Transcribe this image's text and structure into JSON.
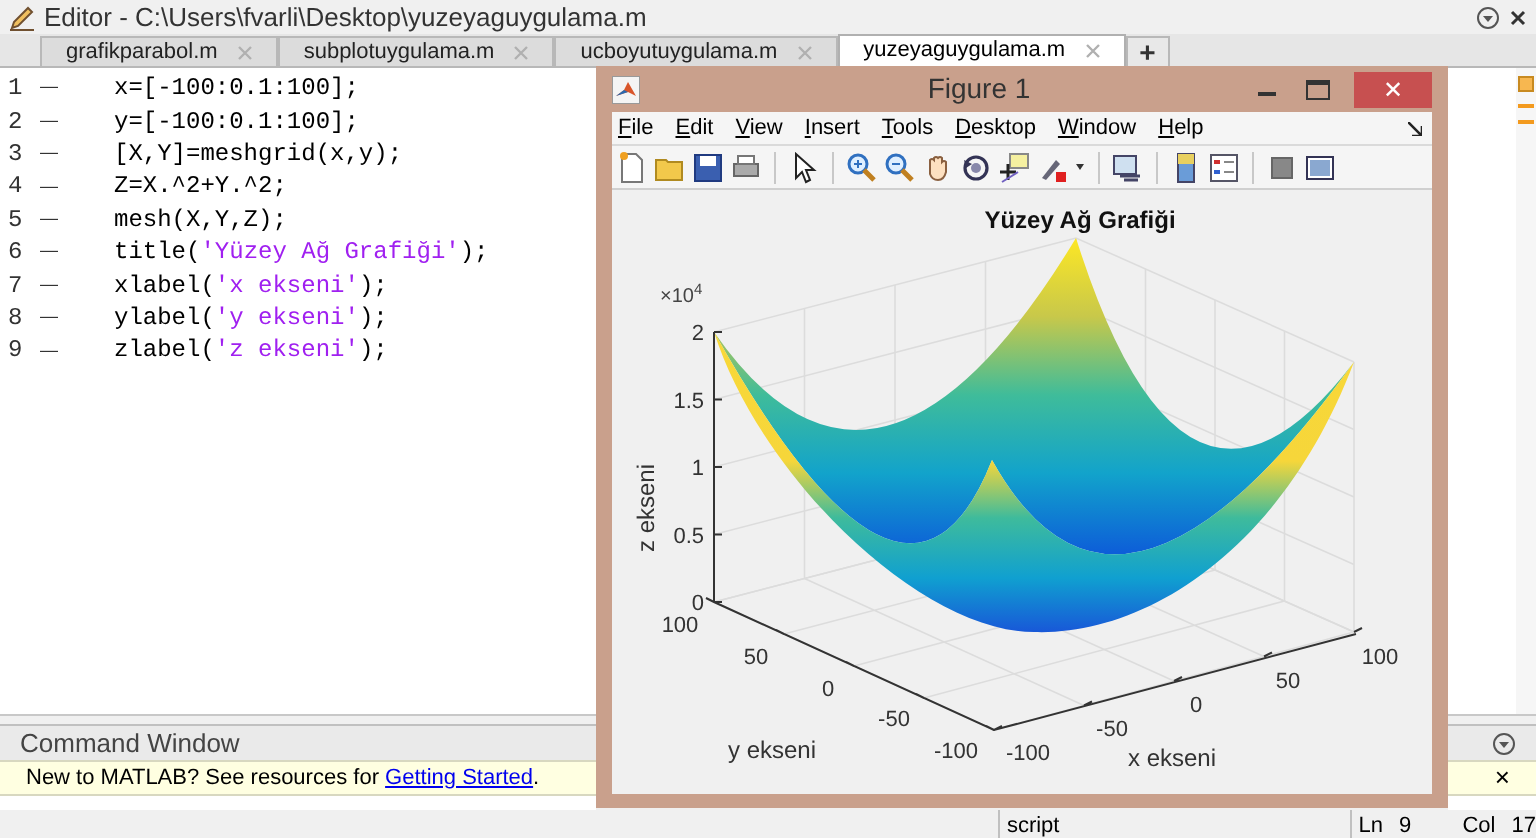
{
  "editor": {
    "title": "Editor - C:\\Users\\fvarli\\Desktop\\yuzeyaguygulama.m",
    "tabs": [
      {
        "label": "grafikparabol.m",
        "selected": false
      },
      {
        "label": "subplotuygulama.m",
        "selected": false
      },
      {
        "label": "ucboyutuygulama.m",
        "selected": false
      },
      {
        "label": "yuzeyaguygulama.m",
        "selected": true
      }
    ],
    "new_tab": "+",
    "lines": [
      {
        "number": "1",
        "marker": "—",
        "segments": [
          {
            "kind": "code",
            "text": "x=[-100:0.1:100];"
          }
        ]
      },
      {
        "number": "2",
        "marker": "—",
        "segments": [
          {
            "kind": "code",
            "text": "y=[-100:0.1:100];"
          }
        ]
      },
      {
        "number": "3",
        "marker": "—",
        "segments": [
          {
            "kind": "code",
            "text": "[X,Y]=meshgrid(x,y);"
          }
        ]
      },
      {
        "number": "4",
        "marker": "—",
        "segments": [
          {
            "kind": "code",
            "text": "Z=X.^2+Y.^2;"
          }
        ]
      },
      {
        "number": "5",
        "marker": "—",
        "segments": [
          {
            "kind": "code",
            "text": "mesh(X,Y,Z);"
          }
        ]
      },
      {
        "number": "6",
        "marker": "—",
        "segments": [
          {
            "kind": "code",
            "text": "title("
          },
          {
            "kind": "string",
            "text": "'Yüzey Ağ Grafiği'"
          },
          {
            "kind": "code",
            "text": ");"
          }
        ]
      },
      {
        "number": "7",
        "marker": "—",
        "segments": [
          {
            "kind": "code",
            "text": "xlabel("
          },
          {
            "kind": "string",
            "text": "'x ekseni'"
          },
          {
            "kind": "code",
            "text": ");"
          }
        ]
      },
      {
        "number": "8",
        "marker": "—",
        "segments": [
          {
            "kind": "code",
            "text": "ylabel("
          },
          {
            "kind": "string",
            "text": "'y ekseni'"
          },
          {
            "kind": "code",
            "text": ");"
          }
        ]
      },
      {
        "number": "9",
        "marker": "—",
        "segments": [
          {
            "kind": "code",
            "text": "zlabel("
          },
          {
            "kind": "string",
            "text": "'z ekseni'"
          },
          {
            "kind": "code",
            "text": ");"
          }
        ]
      }
    ]
  },
  "command_window": {
    "title": "Command Window",
    "notice": "New to MATLAB? See resources for ",
    "link": "Getting Started",
    "notice_end": ".",
    "close": "×"
  },
  "status_bar": {
    "mode": "script",
    "line_label": "Ln",
    "line": "9",
    "col_label": "Col",
    "col": "17"
  },
  "figure": {
    "title": "Figure 1",
    "close": "✕",
    "menu": [
      "File",
      "Edit",
      "View",
      "Insert",
      "Tools",
      "Desktop",
      "Window",
      "Help"
    ],
    "plot": {
      "title": "Yüzey Ağ Grafiği",
      "exponent": "×10$^{4}$",
      "z_ticks": [
        "2",
        "1.5",
        "1",
        "0.5",
        "0"
      ],
      "y_ticks": [
        "100",
        "50",
        "0",
        "-50",
        "-100"
      ],
      "x_ticks": [
        "-100",
        "-50",
        "0",
        "50",
        "100"
      ],
      "xlabel": "x ekseni",
      "ylabel": "y ekseni",
      "zlabel": "z ekseni"
    }
  }
}
